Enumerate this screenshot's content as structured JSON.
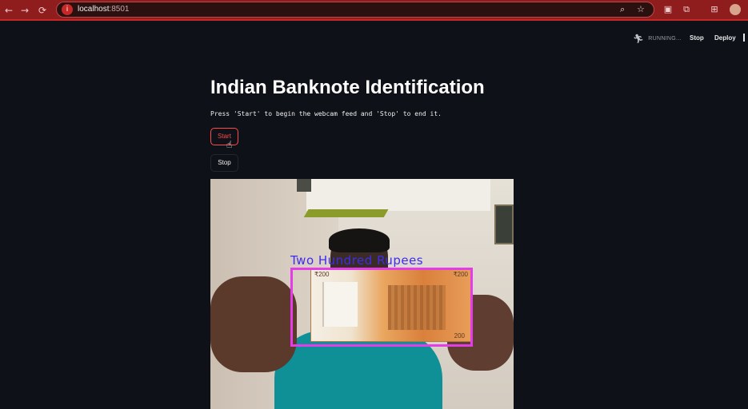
{
  "browser": {
    "url_host": "localhost",
    "url_port": ":8501",
    "nav_back": "←",
    "nav_forward": "→",
    "nav_reload": "⟳",
    "accent_color": "#8f1d1d"
  },
  "header": {
    "status": "RUNNING...",
    "stop_label": "Stop",
    "deploy_label": "Deploy"
  },
  "main": {
    "title": "Indian Banknote Identification",
    "instruction": "Press 'Start' to begin the webcam feed and 'Stop' to end it.",
    "start_label": "Start",
    "stop_label": "Stop"
  },
  "feed": {
    "detection_label": "Two Hundred Rupees",
    "box_color": "#e43ce6",
    "label_color": "#3f2bf0",
    "note_denomination": "₹200",
    "note_denomination_short": "200"
  }
}
